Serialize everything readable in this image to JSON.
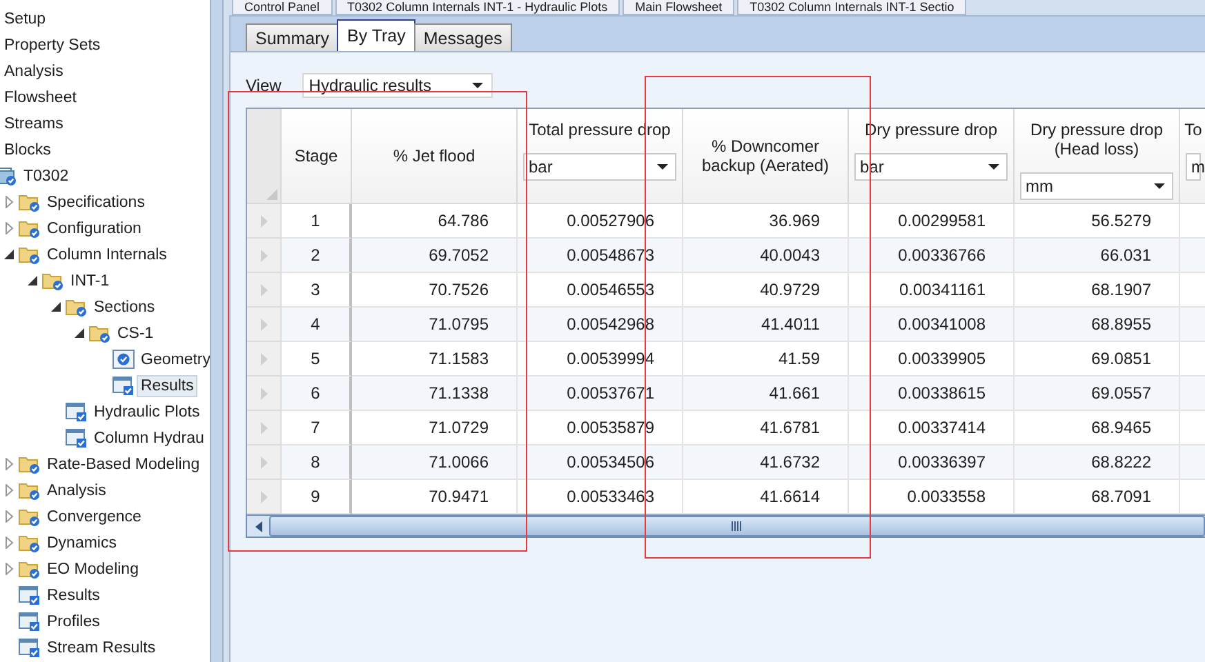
{
  "doc_tabs": [
    {
      "label": "Control Panel"
    },
    {
      "label": "T0302 Column Internals INT-1 - Hydraulic Plots"
    },
    {
      "label": "Main Flowsheet"
    },
    {
      "label": "T0302 Column Internals INT-1 Sectio"
    }
  ],
  "tree": [
    {
      "label": "Setup",
      "kind": "plain",
      "selected": false
    },
    {
      "label": "Property Sets",
      "kind": "plain",
      "selected": false
    },
    {
      "label": "Analysis",
      "kind": "plain",
      "selected": false
    },
    {
      "label": "Flowsheet",
      "kind": "plain",
      "selected": false
    },
    {
      "label": "Streams",
      "kind": "plain",
      "selected": false
    },
    {
      "label": "Blocks",
      "kind": "plain",
      "selected": false,
      "children": [
        {
          "label": "T0302",
          "kind": "block",
          "selected": false,
          "children": [
            {
              "label": "Specifications",
              "kind": "folder",
              "expanded": false,
              "selected": false
            },
            {
              "label": "Configuration",
              "kind": "folder",
              "expanded": false,
              "selected": false
            },
            {
              "label": "Column Internals",
              "kind": "folder",
              "expanded": true,
              "selected": false,
              "children": [
                {
                  "label": "INT-1",
                  "kind": "folder",
                  "expanded": true,
                  "selected": false,
                  "children": [
                    {
                      "label": "Sections",
                      "kind": "folder",
                      "expanded": true,
                      "selected": false,
                      "children": [
                        {
                          "label": "CS-1",
                          "kind": "folder",
                          "expanded": true,
                          "selected": false,
                          "children": [
                            {
                              "label": "Geometry",
                              "kind": "form",
                              "selected": false
                            },
                            {
                              "label": "Results",
                              "kind": "sheet",
                              "selected": true
                            }
                          ]
                        }
                      ]
                    },
                    {
                      "label": "Hydraulic Plots",
                      "kind": "sheet",
                      "selected": false
                    },
                    {
                      "label": "Column Hydrau",
                      "kind": "sheet",
                      "selected": false
                    }
                  ]
                }
              ]
            },
            {
              "label": "Rate-Based Modeling",
              "kind": "folder",
              "expanded": false,
              "selected": false
            },
            {
              "label": "Analysis",
              "kind": "folder",
              "expanded": false,
              "selected": false
            },
            {
              "label": "Convergence",
              "kind": "folder",
              "expanded": false,
              "selected": false
            },
            {
              "label": "Dynamics",
              "kind": "folder",
              "expanded": false,
              "selected": false
            },
            {
              "label": "EO Modeling",
              "kind": "folder",
              "expanded": false,
              "selected": false
            },
            {
              "label": "Results",
              "kind": "sheet",
              "selected": false
            },
            {
              "label": "Profiles",
              "kind": "sheet",
              "selected": false
            },
            {
              "label": "Stream Results",
              "kind": "sheet",
              "selected": false
            }
          ]
        }
      ]
    }
  ],
  "tabs": [
    {
      "label": "Summary",
      "selected": false
    },
    {
      "label": "By Tray",
      "selected": true
    },
    {
      "label": "Messages",
      "selected": false
    }
  ],
  "view": {
    "label": "View",
    "value": "Hydraulic results"
  },
  "table": {
    "columns": [
      {
        "header": "Stage"
      },
      {
        "header": "% Jet flood"
      },
      {
        "header": "Total pressure drop",
        "unit": "bar"
      },
      {
        "header": "% Downcomer backup (Aerated)"
      },
      {
        "header": "Dry pressure drop",
        "unit": "bar"
      },
      {
        "header": "Dry pressure drop (Head loss)",
        "unit": "mm"
      },
      {
        "header": "To",
        "unit": "m"
      }
    ],
    "rows": [
      [
        "1",
        "64.786",
        "0.00527906",
        "36.969",
        "0.00299581",
        "56.5279"
      ],
      [
        "2",
        "69.7052",
        "0.00548673",
        "40.0043",
        "0.00336766",
        "66.031"
      ],
      [
        "3",
        "70.7526",
        "0.00546553",
        "40.9729",
        "0.00341161",
        "68.1907"
      ],
      [
        "4",
        "71.0795",
        "0.00542968",
        "41.4011",
        "0.00341008",
        "68.8955"
      ],
      [
        "5",
        "71.1583",
        "0.00539994",
        "41.59",
        "0.00339905",
        "69.0851"
      ],
      [
        "6",
        "71.1338",
        "0.00537671",
        "41.661",
        "0.00338615",
        "69.0557"
      ],
      [
        "7",
        "71.0729",
        "0.00535879",
        "41.6781",
        "0.00337414",
        "68.9465"
      ],
      [
        "8",
        "71.0066",
        "0.00534506",
        "41.6732",
        "0.00336397",
        "68.8222"
      ],
      [
        "9",
        "70.9471",
        "0.00533463",
        "41.6614",
        "0.0033558",
        "68.7091"
      ]
    ]
  }
}
